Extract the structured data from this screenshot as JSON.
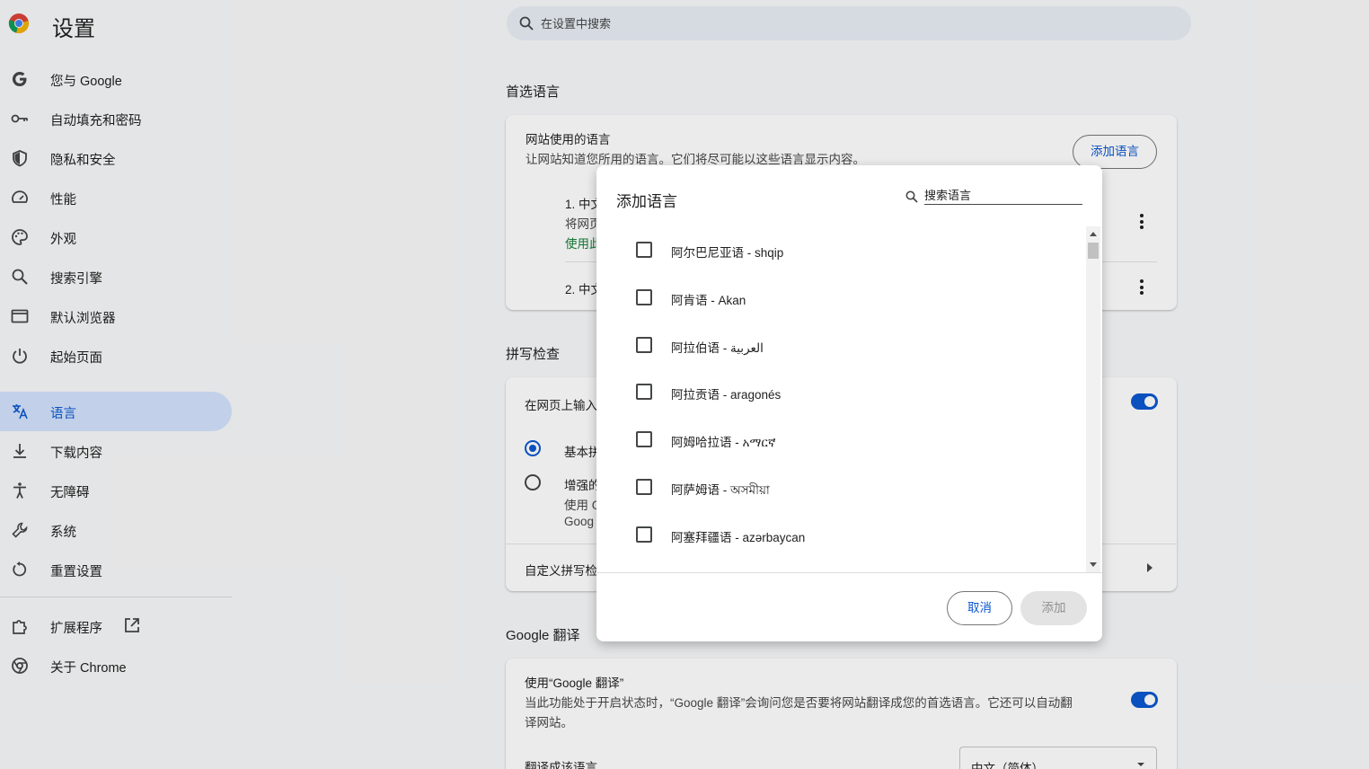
{
  "header": {
    "title": "设置",
    "search_placeholder": "在设置中搜索"
  },
  "sidebar": {
    "items": [
      {
        "label": "您与 Google",
        "icon": "google-icon"
      },
      {
        "label": "自动填充和密码",
        "icon": "key-icon"
      },
      {
        "label": "隐私和安全",
        "icon": "shield-icon"
      },
      {
        "label": "性能",
        "icon": "speedometer-icon"
      },
      {
        "label": "外观",
        "icon": "palette-icon"
      },
      {
        "label": "搜索引擎",
        "icon": "search-icon"
      },
      {
        "label": "默认浏览器",
        "icon": "browser-icon"
      },
      {
        "label": "起始页面",
        "icon": "power-icon"
      },
      {
        "label": "语言",
        "icon": "translate-icon",
        "active": true
      },
      {
        "label": "下载内容",
        "icon": "download-icon"
      },
      {
        "label": "无障碍",
        "icon": "accessibility-icon"
      },
      {
        "label": "系统",
        "icon": "wrench-icon"
      },
      {
        "label": "重置设置",
        "icon": "reset-icon"
      }
    ],
    "extensions": "扩展程序",
    "about": "关于 Chrome"
  },
  "main": {
    "preferred_languages": {
      "title": "首选语言",
      "card_title": "网站使用的语言",
      "card_desc": "让网站知道您所用的语言。它们将尽可能以这些语言显示内容。",
      "add_button": "添加语言",
      "lang1_name": "1. 中文",
      "lang1_sub": "将网页",
      "lang1_flag": "使用此",
      "lang2_name": "2. 中文"
    },
    "spell_check": {
      "title": "拼写检查",
      "row_label": "在网页上输入",
      "option_basic": "基本拼",
      "option_enhanced": "增强的",
      "enhanced_sub1": "使用 G",
      "enhanced_sub2": "Goog",
      "custom": "自定义拼写检"
    },
    "translate": {
      "title": "Google 翻译",
      "row_title": "使用“Google 翻译”",
      "row_desc_line1": "当此功能处于开启状态时，“Google 翻译”会询问您是否要将网站翻译成您的首选语言。它还可以自动翻",
      "row_desc_line2": "译网站。",
      "target_label": "翻译成该语言",
      "target_value": "中文（简体）"
    }
  },
  "dialog": {
    "title": "添加语言",
    "search_placeholder": "搜索语言",
    "languages": [
      "阿尔巴尼亚语 - shqip",
      "阿肯语 - Akan",
      "阿拉伯语 - العربية",
      "阿拉贡语 - aragonés",
      "阿姆哈拉语 - አማርኛ",
      "阿萨姆语 - অসমীয়া",
      "阿塞拜疆语 - azərbaycan"
    ],
    "cancel": "取消",
    "add": "添加"
  },
  "colors": {
    "accent": "#0b57d0",
    "active_nav_bg": "#d3e3fd",
    "page_bg": "#f8f9fa"
  }
}
